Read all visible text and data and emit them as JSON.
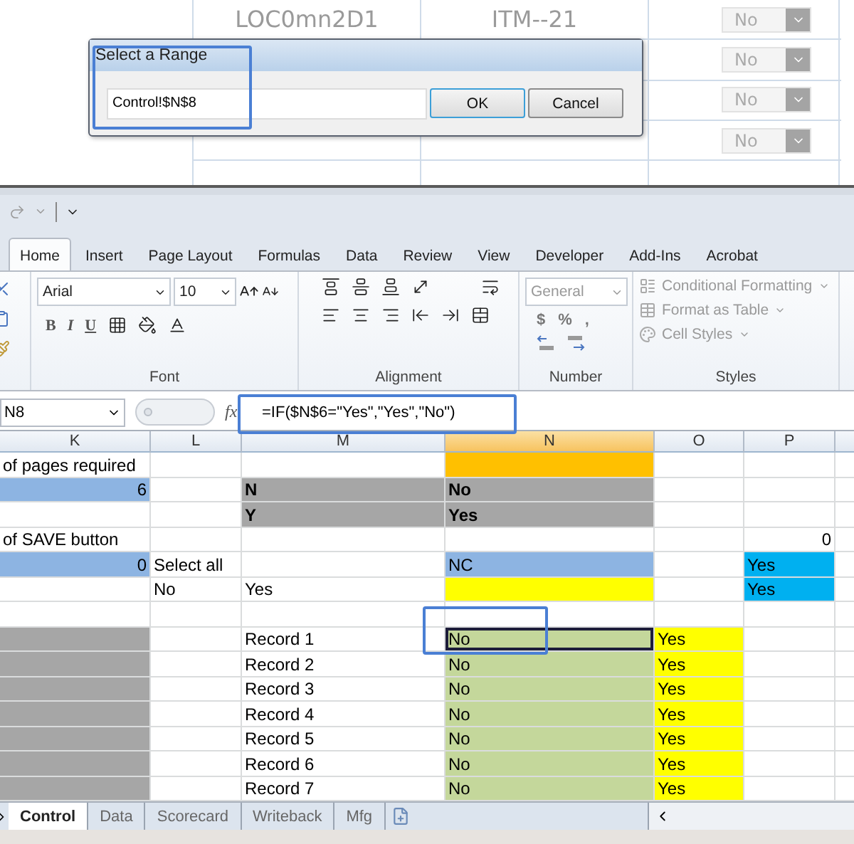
{
  "background_table": {
    "rows": [
      {
        "location": "LOC0mn2D1",
        "item": "ITM--21",
        "choice": "No"
      },
      {
        "choice": "No"
      },
      {
        "choice": "No"
      },
      {
        "choice": "No"
      }
    ]
  },
  "dialog": {
    "title": "Select a Range",
    "value": "Control!$N$8",
    "buttons": [
      "OK",
      "Cancel"
    ]
  },
  "ribbon": {
    "tabs": [
      {
        "label": "Home",
        "selected": true
      },
      {
        "label": "Insert",
        "selected": false
      },
      {
        "label": "Page Layout",
        "selected": false
      },
      {
        "label": "Formulas",
        "selected": false
      },
      {
        "label": "Data",
        "selected": false
      },
      {
        "label": "Review",
        "selected": false
      },
      {
        "label": "View",
        "selected": false
      },
      {
        "label": "Developer",
        "selected": false
      },
      {
        "label": "Add-Ins",
        "selected": false
      },
      {
        "label": "Acrobat",
        "selected": false
      }
    ],
    "font": {
      "name": "Arial",
      "size": "10",
      "styles": [
        "B",
        "I",
        "U"
      ],
      "label": "Font"
    },
    "alignment": {
      "label": "Alignment"
    },
    "number": {
      "format": "General",
      "symbols": [
        "$",
        "%",
        ","
      ],
      "label": "Number"
    },
    "styles": {
      "items": [
        "Conditional Formatting",
        "Format as Table",
        "Cell Styles"
      ],
      "label": "Styles"
    }
  },
  "formula_bar": {
    "name_box": "N8",
    "function_label": "fx",
    "formula": "=IF($N$6=\"Yes\",\"Yes\",\"No\")"
  },
  "sheet": {
    "columns": [
      {
        "label": "K",
        "selected": false
      },
      {
        "label": "L",
        "selected": false
      },
      {
        "label": "M",
        "selected": false
      },
      {
        "label": "N",
        "selected": true
      },
      {
        "label": "O",
        "selected": false
      },
      {
        "label": "P",
        "selected": false
      }
    ],
    "rows": [
      {
        "cells": [
          {
            "kind": "text",
            "text": "of pages required",
            "selected": false
          },
          {
            "kind": "text",
            "selected": false
          },
          {
            "kind": "text",
            "selected": false
          },
          {
            "kind": "text",
            "color": "#ffc000",
            "selected": false
          },
          {
            "kind": "text",
            "selected": false
          },
          {
            "kind": "text",
            "selected": false
          }
        ]
      },
      {
        "cells": [
          {
            "kind": "number",
            "text": "6",
            "color": "#8db4e2",
            "selected": false
          },
          {
            "kind": "text",
            "selected": false
          },
          {
            "kind": "heading",
            "text": "N",
            "color": "#a6a6a6",
            "selected": false
          },
          {
            "kind": "heading",
            "text": "No",
            "color": "#a6a6a6",
            "selected": false
          },
          {
            "kind": "text",
            "selected": false
          },
          {
            "kind": "text",
            "selected": false
          }
        ]
      },
      {
        "cells": [
          {
            "kind": "text",
            "selected": false
          },
          {
            "kind": "text",
            "selected": false
          },
          {
            "kind": "heading",
            "text": "Y",
            "color": "#a6a6a6",
            "selected": false
          },
          {
            "kind": "heading",
            "text": "Yes",
            "color": "#a6a6a6",
            "selected": false
          },
          {
            "kind": "text",
            "selected": false
          },
          {
            "kind": "text",
            "selected": false
          }
        ]
      },
      {
        "cells": [
          {
            "kind": "text",
            "text": "of SAVE button",
            "selected": false
          },
          {
            "kind": "text",
            "selected": false
          },
          {
            "kind": "text",
            "selected": false
          },
          {
            "kind": "text",
            "selected": false
          },
          {
            "kind": "text",
            "selected": false
          },
          {
            "kind": "number",
            "text": "0",
            "selected": false
          }
        ]
      },
      {
        "cells": [
          {
            "kind": "number",
            "text": "0",
            "color": "#8db4e2",
            "selected": false
          },
          {
            "kind": "text",
            "text": "Select all",
            "selected": false
          },
          {
            "kind": "text",
            "selected": false
          },
          {
            "kind": "text",
            "text": "NC",
            "color": "#8db4e2",
            "selected": false
          },
          {
            "kind": "text",
            "selected": false
          },
          {
            "kind": "text",
            "text": "Yes",
            "color": "#00b0f0",
            "selected": false
          }
        ]
      },
      {
        "cells": [
          {
            "kind": "text",
            "selected": false
          },
          {
            "kind": "text",
            "text": "No",
            "selected": false
          },
          {
            "kind": "text",
            "text": "Yes",
            "selected": false
          },
          {
            "kind": "text",
            "color": "#ffff00",
            "selected": false
          },
          {
            "kind": "text",
            "selected": false
          },
          {
            "kind": "text",
            "text": "Yes",
            "color": "#00b0f0",
            "selected": false
          }
        ]
      },
      {
        "cells": [
          {
            "kind": "text",
            "selected": false
          },
          {
            "kind": "text",
            "selected": false
          },
          {
            "kind": "text",
            "selected": false
          },
          {
            "kind": "text",
            "selected": false
          },
          {
            "kind": "text",
            "selected": false
          },
          {
            "kind": "text",
            "selected": false
          }
        ]
      },
      {
        "cells": [
          {
            "kind": "text",
            "color": "#a6a6a6",
            "selected": false
          },
          {
            "kind": "text",
            "selected": false
          },
          {
            "kind": "text",
            "text": "Record 1",
            "selected": false
          },
          {
            "kind": "text",
            "text": "No",
            "color": "#c4d79b",
            "selected": true
          },
          {
            "kind": "text",
            "text": "Yes",
            "color": "#ffff00",
            "selected": false
          },
          {
            "kind": "text",
            "selected": false
          }
        ]
      },
      {
        "cells": [
          {
            "kind": "text",
            "color": "#a6a6a6",
            "selected": false
          },
          {
            "kind": "text",
            "selected": false
          },
          {
            "kind": "text",
            "text": "Record 2",
            "selected": false
          },
          {
            "kind": "text",
            "text": "No",
            "color": "#c4d79b",
            "selected": false
          },
          {
            "kind": "text",
            "text": "Yes",
            "color": "#ffff00",
            "selected": false
          },
          {
            "kind": "text",
            "selected": false
          }
        ]
      },
      {
        "cells": [
          {
            "kind": "text",
            "color": "#a6a6a6",
            "selected": false
          },
          {
            "kind": "text",
            "selected": false
          },
          {
            "kind": "text",
            "text": "Record 3",
            "selected": false
          },
          {
            "kind": "text",
            "text": "No",
            "color": "#c4d79b",
            "selected": false
          },
          {
            "kind": "text",
            "text": "Yes",
            "color": "#ffff00",
            "selected": false
          },
          {
            "kind": "text",
            "selected": false
          }
        ]
      },
      {
        "cells": [
          {
            "kind": "text",
            "color": "#a6a6a6",
            "selected": false
          },
          {
            "kind": "text",
            "selected": false
          },
          {
            "kind": "text",
            "text": "Record 4",
            "selected": false
          },
          {
            "kind": "text",
            "text": "No",
            "color": "#c4d79b",
            "selected": false
          },
          {
            "kind": "text",
            "text": "Yes",
            "color": "#ffff00",
            "selected": false
          },
          {
            "kind": "text",
            "selected": false
          }
        ]
      },
      {
        "cells": [
          {
            "kind": "text",
            "color": "#a6a6a6",
            "selected": false
          },
          {
            "kind": "text",
            "selected": false
          },
          {
            "kind": "text",
            "text": "Record 5",
            "selected": false
          },
          {
            "kind": "text",
            "text": "No",
            "color": "#c4d79b",
            "selected": false
          },
          {
            "kind": "text",
            "text": "Yes",
            "color": "#ffff00",
            "selected": false
          },
          {
            "kind": "text",
            "selected": false
          }
        ]
      },
      {
        "cells": [
          {
            "kind": "text",
            "color": "#a6a6a6",
            "selected": false
          },
          {
            "kind": "text",
            "selected": false
          },
          {
            "kind": "text",
            "text": "Record 6",
            "selected": false
          },
          {
            "kind": "text",
            "text": "No",
            "color": "#c4d79b",
            "selected": false
          },
          {
            "kind": "text",
            "text": "Yes",
            "color": "#ffff00",
            "selected": false
          },
          {
            "kind": "text",
            "selected": false
          }
        ]
      },
      {
        "cells": [
          {
            "kind": "text",
            "color": "#a6a6a6",
            "selected": false
          },
          {
            "kind": "text",
            "selected": false
          },
          {
            "kind": "text",
            "text": "Record 7",
            "selected": false
          },
          {
            "kind": "text",
            "text": "No",
            "color": "#c4d79b",
            "selected": false
          },
          {
            "kind": "text",
            "text": "Yes",
            "color": "#ffff00",
            "selected": false
          },
          {
            "kind": "text",
            "selected": false
          }
        ]
      }
    ]
  },
  "sheet_tabs": [
    {
      "label": "Control",
      "selected": true
    },
    {
      "label": "Data",
      "selected": false
    },
    {
      "label": "Scorecard",
      "selected": false
    },
    {
      "label": "Writeback",
      "selected": false
    },
    {
      "label": "Mfg",
      "selected": false
    }
  ]
}
